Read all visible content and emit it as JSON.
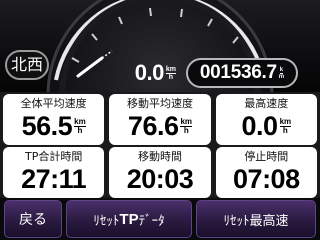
{
  "dashboard": {
    "heading": "北西",
    "speed": {
      "value": "0.0",
      "unit_top": "km",
      "unit_bottom": "h"
    },
    "odometer": {
      "value": "001536.7",
      "unit_top": "k",
      "unit_bottom": "m"
    }
  },
  "stats": [
    {
      "label": "全体平均速度",
      "value": "56.5",
      "unit_top": "km",
      "unit_bottom": "h"
    },
    {
      "label": "移動平均速度",
      "value": "76.6",
      "unit_top": "km",
      "unit_bottom": "h"
    },
    {
      "label": "最高速度",
      "value": "0.0",
      "unit_top": "km",
      "unit_bottom": "h"
    },
    {
      "label": "TP合計時間",
      "value": "27:11"
    },
    {
      "label": "移動時間",
      "value": "20:03"
    },
    {
      "label": "停止時間",
      "value": "07:08"
    }
  ],
  "buttons": {
    "back": "戻る",
    "reset_tp_prefix": "ﾘｾｯﾄ",
    "reset_tp_bold": "TP",
    "reset_tp_suffix": "ﾃﾞｰﾀ",
    "reset_max": "ﾘｾｯﾄ最高速"
  },
  "colors": {
    "button_purple": "#3a2456",
    "gauge_arc": "#e8e8e8",
    "panel_white": "#ffffff"
  },
  "icons": {
    "gauge": "speedometer-dial-icon",
    "needle": "gauge-needle-icon"
  }
}
